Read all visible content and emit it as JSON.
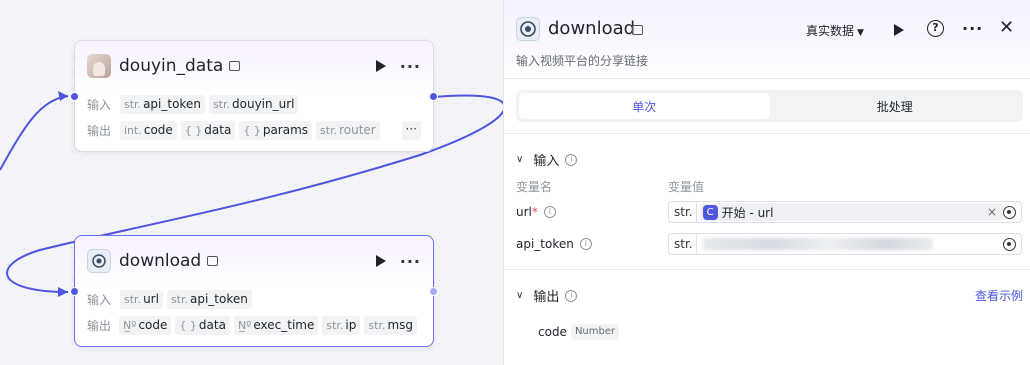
{
  "canvas": {
    "nodes": [
      {
        "title": "douyin_data",
        "icon": "douyin-avatar-icon",
        "input_label": "输入",
        "output_label": "输出",
        "inputs": [
          {
            "type": "str.",
            "name": "api_token"
          },
          {
            "type": "str.",
            "name": "douyin_url"
          }
        ],
        "outputs": [
          {
            "type": "int.",
            "name": "code"
          },
          {
            "type": "{ }",
            "name": "data"
          },
          {
            "type": "{ }",
            "name": "params"
          },
          {
            "type": "str.",
            "name": "router"
          }
        ],
        "more_label": "···"
      },
      {
        "title": "download",
        "icon": "download-plugin-icon",
        "input_label": "输入",
        "output_label": "输出",
        "inputs": [
          {
            "type": "str.",
            "name": "url"
          },
          {
            "type": "str.",
            "name": "api_token"
          }
        ],
        "outputs": [
          {
            "type": "N̲º",
            "name": "code"
          },
          {
            "type": "{ }",
            "name": "data"
          },
          {
            "type": "N̲º",
            "name": "exec_time"
          },
          {
            "type": "str.",
            "name": "ip"
          },
          {
            "type": "str.",
            "name": "msg"
          }
        ]
      }
    ],
    "edge_color": "#4e55e0"
  },
  "panel": {
    "title": "download",
    "description": "输入视频平台的分享链接",
    "mode_label": "真实数据",
    "tabs": [
      {
        "label": "单次",
        "active": true
      },
      {
        "label": "批处理",
        "active": false
      }
    ],
    "input_section": {
      "title": "输入",
      "col_name": "变量名",
      "col_value": "变量值",
      "vars": [
        {
          "name": "url",
          "required": true,
          "type": "str.",
          "ref": "开始 - url"
        },
        {
          "name": "api_token",
          "required": false,
          "type": "str.",
          "ref": ""
        }
      ]
    },
    "output_section": {
      "title": "输出",
      "example_link": "查看示例",
      "items": [
        {
          "name": "code",
          "type": "Number"
        }
      ]
    },
    "accent_color": "#4e55e0"
  }
}
